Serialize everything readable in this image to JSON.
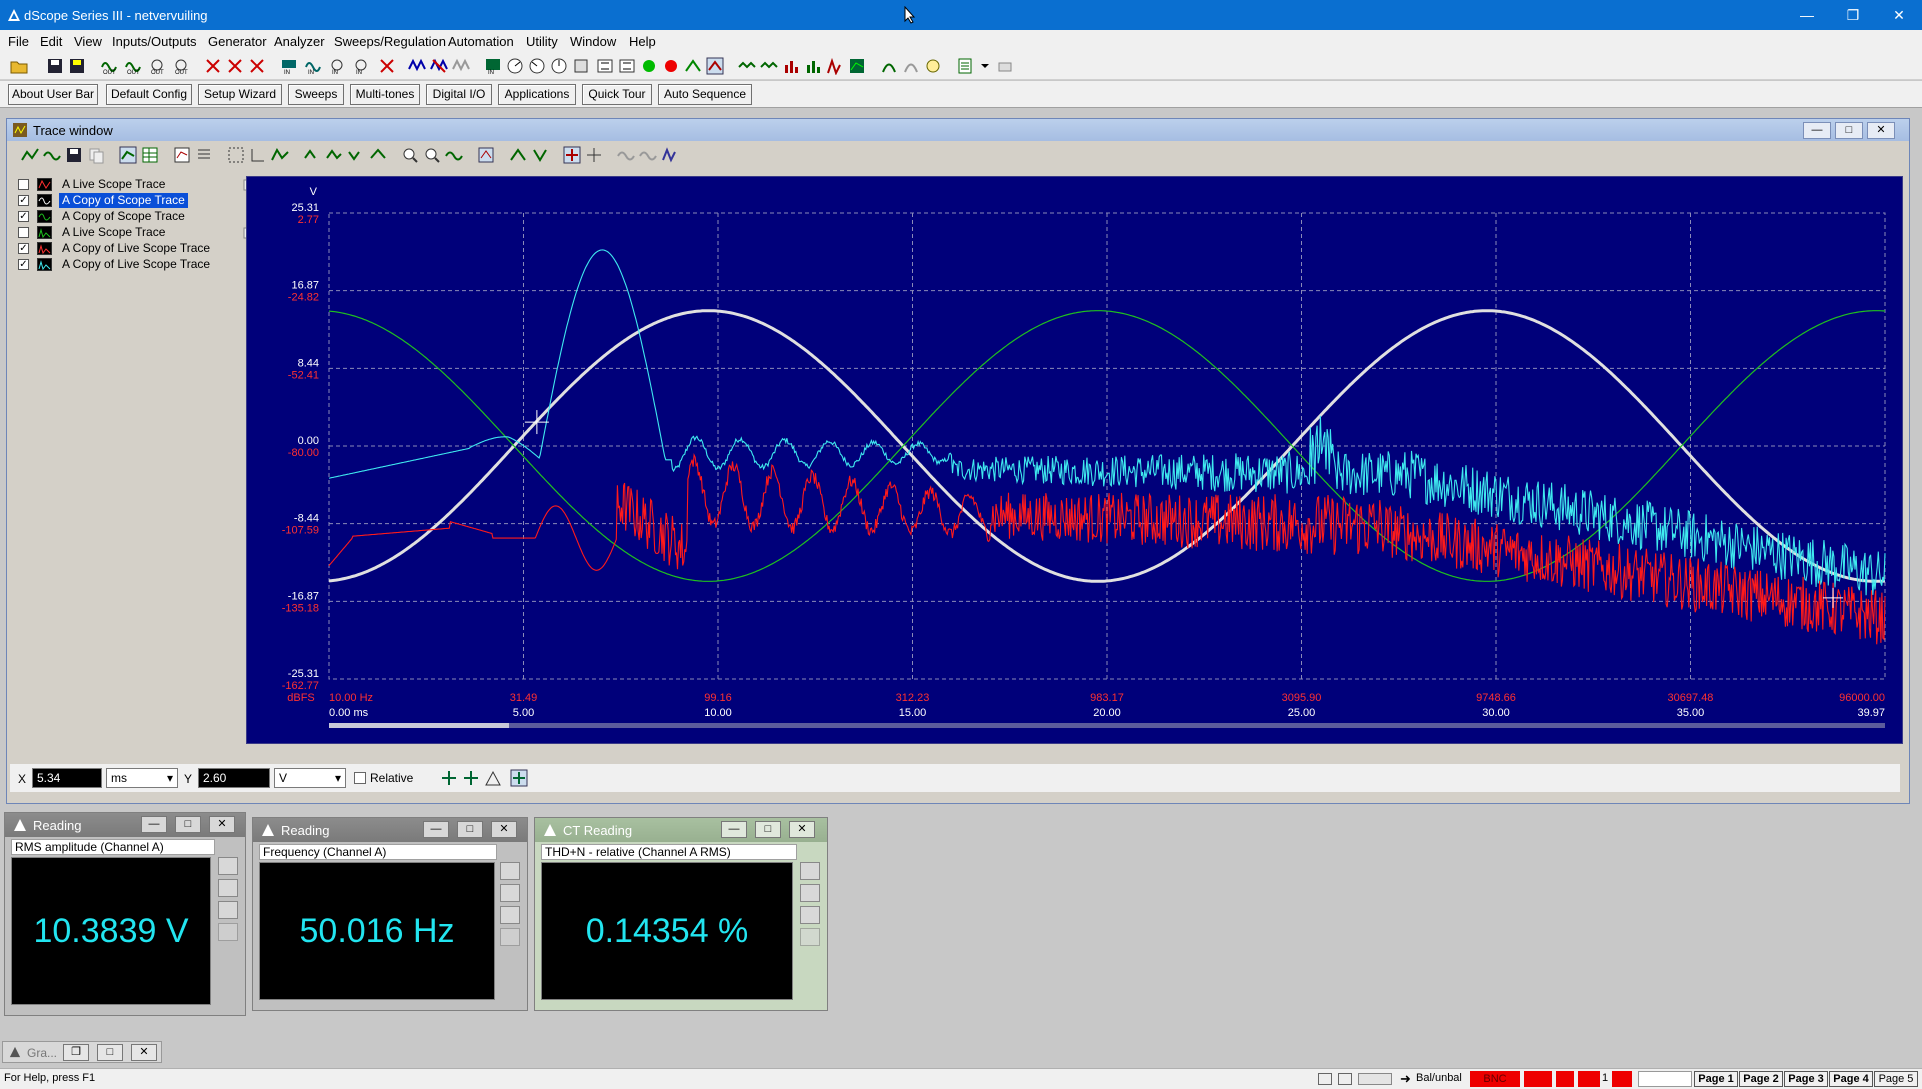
{
  "window": {
    "title": "dScope Series III - netvervuiling"
  },
  "menu": [
    "File",
    "Edit",
    "View",
    "Inputs/Outputs",
    "Generator",
    "Analyzer",
    "Sweeps/Regulation",
    "Automation",
    "Utility",
    "Window",
    "Help"
  ],
  "user_bar": [
    "About User Bar",
    "Default Config",
    "Setup Wizard",
    "Sweeps",
    "Multi-tones",
    "Digital I/O",
    "Applications",
    "Quick Tour",
    "Auto Sequence"
  ],
  "trace_window": {
    "title": "Trace window",
    "traces": [
      {
        "checked": false,
        "label": "A  Live Scope Trace",
        "selected": false
      },
      {
        "checked": true,
        "label": "A  Copy of Scope Trace",
        "selected": true
      },
      {
        "checked": true,
        "label": "A  Copy of Scope Trace",
        "selected": false
      },
      {
        "checked": false,
        "label": "A  Live Scope Trace",
        "selected": false
      },
      {
        "checked": true,
        "label": "A  Copy of Live Scope Trace",
        "selected": false
      },
      {
        "checked": true,
        "label": "A  Copy of Live Scope Trace",
        "selected": false
      }
    ],
    "cursor": {
      "x_label": "X",
      "x_value": "5.34",
      "x_unit": "ms",
      "y_label": "Y",
      "y_value": "2.60",
      "y_unit": "V",
      "relative_label": "Relative"
    }
  },
  "chart_data": {
    "type": "line",
    "y_unit_label": "V",
    "y2_unit_label": "dBFS",
    "y_ticks_V": [
      "25.31",
      "16.87",
      "8.44",
      "0.00",
      "-8.44",
      "-16.87",
      "-25.31"
    ],
    "y_ticks_dBFS": [
      "2.77",
      "-24.82",
      "-52.41",
      "-80.00",
      "-107.59",
      "-135.18",
      "-162.77"
    ],
    "x_ticks_Hz": [
      "10.00 Hz",
      "31.49",
      "99.16",
      "312.23",
      "983.17",
      "3095.90",
      "9748.66",
      "30697.48",
      "96000.00"
    ],
    "x_ticks_ms": [
      "0.00 ms",
      "5.00",
      "10.00",
      "15.00",
      "20.00",
      "25.00",
      "30.00",
      "35.00",
      "39.97"
    ],
    "ylim_V": [
      -25.31,
      25.31
    ],
    "ylim_dBFS": [
      -162.77,
      2.77
    ],
    "xlim_ms": [
      0,
      39.97
    ],
    "grid": true,
    "series": [
      {
        "color": "#e0e0e0",
        "kind": "sine",
        "amplitude_V": 14.7,
        "frequency_Hz": 50.016,
        "phase": "rising zero-crossing near 4.8 ms"
      },
      {
        "color": "#1fc01f",
        "kind": "sine",
        "amplitude_V": 14.7,
        "frequency_Hz": 50.016,
        "phase": "inverted relative to white trace"
      },
      {
        "color": "#3fe9ef",
        "kind": "spectrum"
      },
      {
        "color": "#ff1a1a",
        "kind": "spectrum"
      }
    ]
  },
  "readings": [
    {
      "title": "Reading",
      "caption": "RMS amplitude (Channel A)",
      "value": "10.3839 V"
    },
    {
      "title": "Reading",
      "caption": "Frequency (Channel A)",
      "value": "50.016 Hz"
    },
    {
      "title": "CT Reading",
      "caption": "THD+N - relative (Channel A RMS)",
      "value": "0.14354 %"
    }
  ],
  "minimized": {
    "label": "Gra..."
  },
  "status": {
    "help": "For Help, press F1",
    "balunbal": "Bal/unbal",
    "bnc": "BNC",
    "input_count": "1",
    "pages": [
      "Page 1",
      "Page 2",
      "Page 3",
      "Page 4",
      "Page 5"
    ]
  },
  "colors": {
    "plot_bg": "#00007a",
    "grid": "#8a8ab8",
    "accent": "#0a6fd0"
  }
}
